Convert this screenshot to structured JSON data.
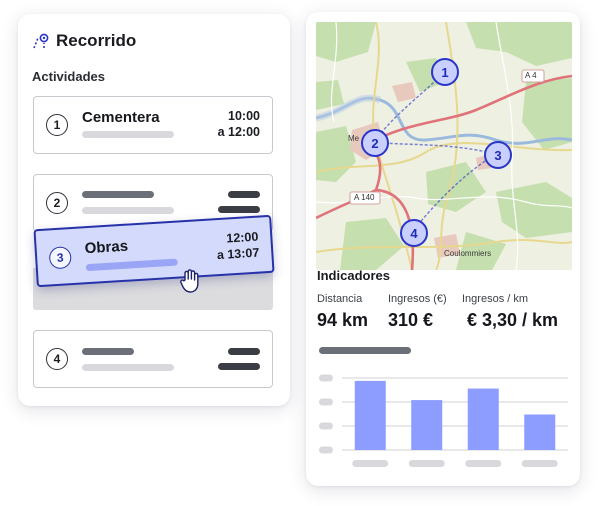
{
  "route": {
    "title": "Recorrido",
    "section": "Actividades",
    "activities": [
      {
        "number": "1",
        "name": "Cementera",
        "time_start": "10:00",
        "time_end": "a 12:00"
      },
      {
        "number": "2"
      },
      {
        "number": "3",
        "name": "Obras",
        "time_start": "12:00",
        "time_end": "a 13:07",
        "state": "dragging"
      },
      {
        "number": "4"
      }
    ]
  },
  "map": {
    "pins": [
      "1",
      "2",
      "3",
      "4"
    ],
    "road_labels": [
      "A 4",
      "A 140"
    ],
    "place_labels": [
      "Coulommiers",
      "Me"
    ]
  },
  "indicators": {
    "title": "Indicadores",
    "kpis": [
      {
        "label": "Distancia",
        "value": "94 km"
      },
      {
        "label": "Ingresos (€)",
        "value": "310 €"
      },
      {
        "label": "Ingresos / km",
        "value": "€ 3,30 / km"
      }
    ]
  },
  "chart_data": {
    "type": "bar",
    "categories": [
      "",
      "",
      "",
      ""
    ],
    "values": [
      72,
      52,
      64,
      37
    ],
    "ylim": [
      0,
      100
    ],
    "grid": true,
    "color": "#8c9cff"
  },
  "colors": {
    "accent": "#2832a8",
    "drag_fill": "#d4dafc",
    "bar": "#8c9cff"
  },
  "icons": {
    "route": "route-pin-icon",
    "cursor": "grab-hand-icon"
  }
}
